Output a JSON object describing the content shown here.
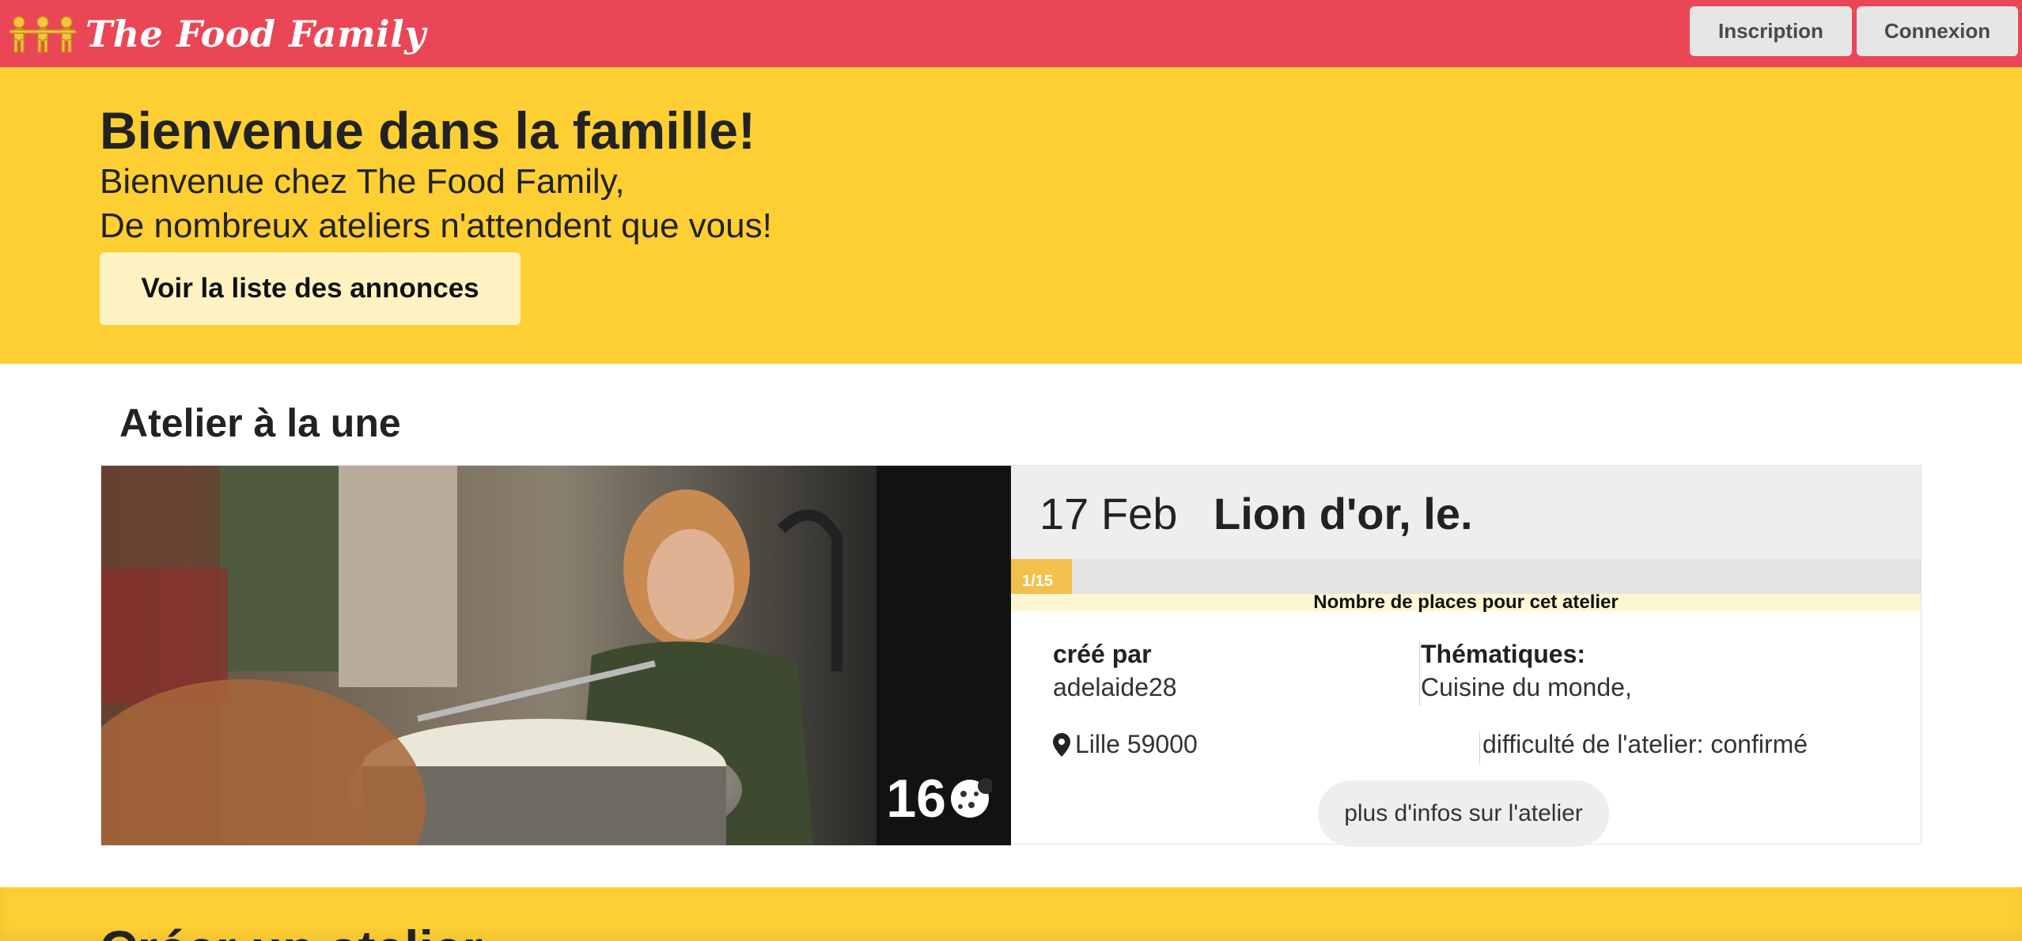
{
  "brand": {
    "title": "The Food Family",
    "color": "#ea4656"
  },
  "nav": {
    "inscription": "Inscription",
    "connexion": "Connexion"
  },
  "hero": {
    "heading": "Bienvenue dans la famille!",
    "line1": "Bienvenue chez The Food Family,",
    "line2": "De nombreux ateliers n'attendent que vous!",
    "cta": "Voir la liste des annonces",
    "background": "#fecf33"
  },
  "featured": {
    "section_title": "Atelier à la une",
    "points": "16",
    "date": "17 Feb",
    "name": "Lion d'or, le.",
    "progress_text": "1/15",
    "progress_fraction": 0.0667,
    "places_label": "Nombre de places pour cet atelier",
    "created_by_label": "créé par",
    "created_by": "adelaide28",
    "themes_label": "Thématiques:",
    "themes": "Cuisine du monde,",
    "location": "Lille 59000",
    "difficulty": "difficulté de l'atelier: confirmé",
    "more_button": "plus d'infos sur l'atelier"
  },
  "bottom": {
    "title": "Créer un atelier"
  },
  "icons": {
    "brand": "people-chain-icon",
    "points": "cookie-icon",
    "location": "map-pin-icon"
  }
}
